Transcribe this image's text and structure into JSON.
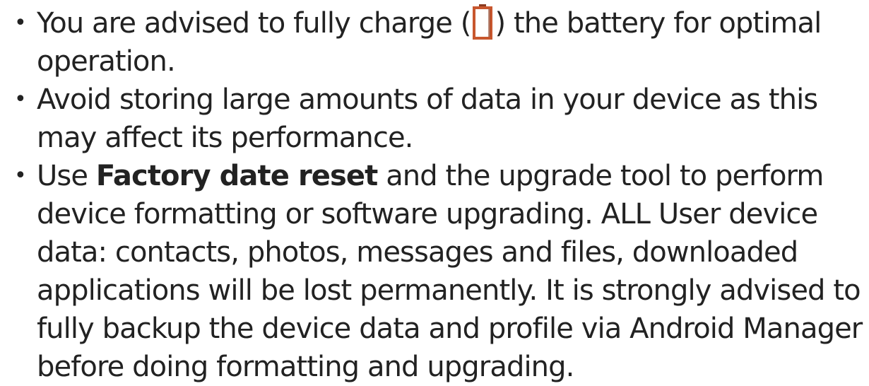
{
  "tips": [
    {
      "bullet": "•",
      "before": "You are advised to fully charge (",
      "icon": "battery-icon",
      "after": ") the battery for optimal operation."
    },
    {
      "bullet": "•",
      "text": "Avoid storing large amounts of data in your device as this may affect its performance."
    },
    {
      "bullet": "•",
      "before": "Use ",
      "strong": "Factory date reset",
      "after": " and the upgrade tool to perform device formatting or software upgrading. ALL User device data: contacts, photos, messages and files, downloaded applications will be lost permanently. It is strongly advised to fully backup the device data and profile via Android Manager before doing formatting and upgrading."
    }
  ],
  "colors": {
    "text": "#222222",
    "battery_outline": "#c8572e",
    "battery_shade": "#8a3a1f"
  }
}
